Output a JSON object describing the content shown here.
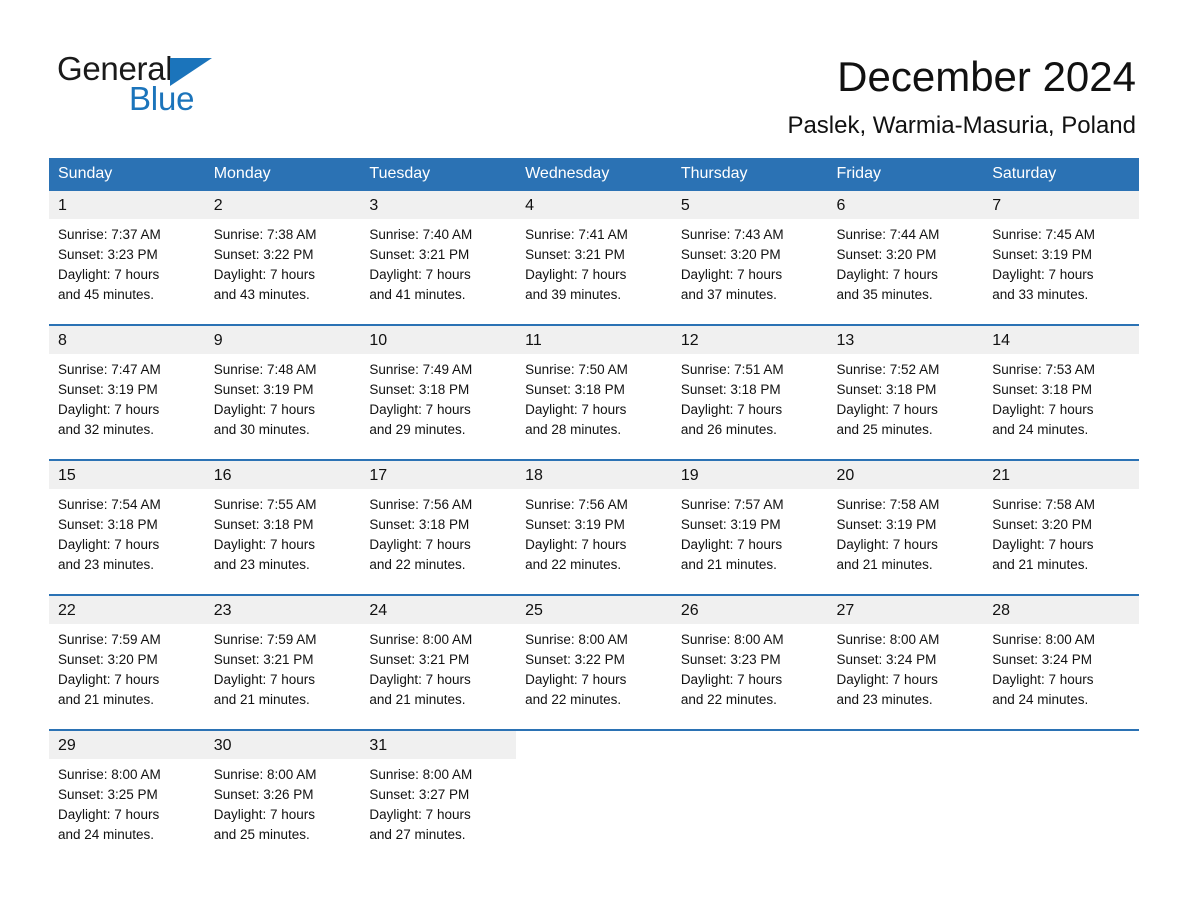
{
  "logo": {
    "word1": "General",
    "word2": "Blue",
    "flag_icon": "triangle-flag-icon",
    "brand_color": "#1b74bb"
  },
  "header": {
    "title": "December 2024",
    "subtitle": "Paslek, Warmia-Masuria, Poland"
  },
  "theme": {
    "header_blue": "#2b72b4",
    "daynum_gray": "#f0f0f0",
    "text_black": "#111111"
  },
  "calendar": {
    "weekday_headers": [
      "Sunday",
      "Monday",
      "Tuesday",
      "Wednesday",
      "Thursday",
      "Friday",
      "Saturday"
    ],
    "weeks": [
      [
        {
          "day": "1",
          "sunrise": "Sunrise: 7:37 AM",
          "sunset": "Sunset: 3:23 PM",
          "daylight1": "Daylight: 7 hours",
          "daylight2": "and 45 minutes."
        },
        {
          "day": "2",
          "sunrise": "Sunrise: 7:38 AM",
          "sunset": "Sunset: 3:22 PM",
          "daylight1": "Daylight: 7 hours",
          "daylight2": "and 43 minutes."
        },
        {
          "day": "3",
          "sunrise": "Sunrise: 7:40 AM",
          "sunset": "Sunset: 3:21 PM",
          "daylight1": "Daylight: 7 hours",
          "daylight2": "and 41 minutes."
        },
        {
          "day": "4",
          "sunrise": "Sunrise: 7:41 AM",
          "sunset": "Sunset: 3:21 PM",
          "daylight1": "Daylight: 7 hours",
          "daylight2": "and 39 minutes."
        },
        {
          "day": "5",
          "sunrise": "Sunrise: 7:43 AM",
          "sunset": "Sunset: 3:20 PM",
          "daylight1": "Daylight: 7 hours",
          "daylight2": "and 37 minutes."
        },
        {
          "day": "6",
          "sunrise": "Sunrise: 7:44 AM",
          "sunset": "Sunset: 3:20 PM",
          "daylight1": "Daylight: 7 hours",
          "daylight2": "and 35 minutes."
        },
        {
          "day": "7",
          "sunrise": "Sunrise: 7:45 AM",
          "sunset": "Sunset: 3:19 PM",
          "daylight1": "Daylight: 7 hours",
          "daylight2": "and 33 minutes."
        }
      ],
      [
        {
          "day": "8",
          "sunrise": "Sunrise: 7:47 AM",
          "sunset": "Sunset: 3:19 PM",
          "daylight1": "Daylight: 7 hours",
          "daylight2": "and 32 minutes."
        },
        {
          "day": "9",
          "sunrise": "Sunrise: 7:48 AM",
          "sunset": "Sunset: 3:19 PM",
          "daylight1": "Daylight: 7 hours",
          "daylight2": "and 30 minutes."
        },
        {
          "day": "10",
          "sunrise": "Sunrise: 7:49 AM",
          "sunset": "Sunset: 3:18 PM",
          "daylight1": "Daylight: 7 hours",
          "daylight2": "and 29 minutes."
        },
        {
          "day": "11",
          "sunrise": "Sunrise: 7:50 AM",
          "sunset": "Sunset: 3:18 PM",
          "daylight1": "Daylight: 7 hours",
          "daylight2": "and 28 minutes."
        },
        {
          "day": "12",
          "sunrise": "Sunrise: 7:51 AM",
          "sunset": "Sunset: 3:18 PM",
          "daylight1": "Daylight: 7 hours",
          "daylight2": "and 26 minutes."
        },
        {
          "day": "13",
          "sunrise": "Sunrise: 7:52 AM",
          "sunset": "Sunset: 3:18 PM",
          "daylight1": "Daylight: 7 hours",
          "daylight2": "and 25 minutes."
        },
        {
          "day": "14",
          "sunrise": "Sunrise: 7:53 AM",
          "sunset": "Sunset: 3:18 PM",
          "daylight1": "Daylight: 7 hours",
          "daylight2": "and 24 minutes."
        }
      ],
      [
        {
          "day": "15",
          "sunrise": "Sunrise: 7:54 AM",
          "sunset": "Sunset: 3:18 PM",
          "daylight1": "Daylight: 7 hours",
          "daylight2": "and 23 minutes."
        },
        {
          "day": "16",
          "sunrise": "Sunrise: 7:55 AM",
          "sunset": "Sunset: 3:18 PM",
          "daylight1": "Daylight: 7 hours",
          "daylight2": "and 23 minutes."
        },
        {
          "day": "17",
          "sunrise": "Sunrise: 7:56 AM",
          "sunset": "Sunset: 3:18 PM",
          "daylight1": "Daylight: 7 hours",
          "daylight2": "and 22 minutes."
        },
        {
          "day": "18",
          "sunrise": "Sunrise: 7:56 AM",
          "sunset": "Sunset: 3:19 PM",
          "daylight1": "Daylight: 7 hours",
          "daylight2": "and 22 minutes."
        },
        {
          "day": "19",
          "sunrise": "Sunrise: 7:57 AM",
          "sunset": "Sunset: 3:19 PM",
          "daylight1": "Daylight: 7 hours",
          "daylight2": "and 21 minutes."
        },
        {
          "day": "20",
          "sunrise": "Sunrise: 7:58 AM",
          "sunset": "Sunset: 3:19 PM",
          "daylight1": "Daylight: 7 hours",
          "daylight2": "and 21 minutes."
        },
        {
          "day": "21",
          "sunrise": "Sunrise: 7:58 AM",
          "sunset": "Sunset: 3:20 PM",
          "daylight1": "Daylight: 7 hours",
          "daylight2": "and 21 minutes."
        }
      ],
      [
        {
          "day": "22",
          "sunrise": "Sunrise: 7:59 AM",
          "sunset": "Sunset: 3:20 PM",
          "daylight1": "Daylight: 7 hours",
          "daylight2": "and 21 minutes."
        },
        {
          "day": "23",
          "sunrise": "Sunrise: 7:59 AM",
          "sunset": "Sunset: 3:21 PM",
          "daylight1": "Daylight: 7 hours",
          "daylight2": "and 21 minutes."
        },
        {
          "day": "24",
          "sunrise": "Sunrise: 8:00 AM",
          "sunset": "Sunset: 3:21 PM",
          "daylight1": "Daylight: 7 hours",
          "daylight2": "and 21 minutes."
        },
        {
          "day": "25",
          "sunrise": "Sunrise: 8:00 AM",
          "sunset": "Sunset: 3:22 PM",
          "daylight1": "Daylight: 7 hours",
          "daylight2": "and 22 minutes."
        },
        {
          "day": "26",
          "sunrise": "Sunrise: 8:00 AM",
          "sunset": "Sunset: 3:23 PM",
          "daylight1": "Daylight: 7 hours",
          "daylight2": "and 22 minutes."
        },
        {
          "day": "27",
          "sunrise": "Sunrise: 8:00 AM",
          "sunset": "Sunset: 3:24 PM",
          "daylight1": "Daylight: 7 hours",
          "daylight2": "and 23 minutes."
        },
        {
          "day": "28",
          "sunrise": "Sunrise: 8:00 AM",
          "sunset": "Sunset: 3:24 PM",
          "daylight1": "Daylight: 7 hours",
          "daylight2": "and 24 minutes."
        }
      ],
      [
        {
          "day": "29",
          "sunrise": "Sunrise: 8:00 AM",
          "sunset": "Sunset: 3:25 PM",
          "daylight1": "Daylight: 7 hours",
          "daylight2": "and 24 minutes."
        },
        {
          "day": "30",
          "sunrise": "Sunrise: 8:00 AM",
          "sunset": "Sunset: 3:26 PM",
          "daylight1": "Daylight: 7 hours",
          "daylight2": "and 25 minutes."
        },
        {
          "day": "31",
          "sunrise": "Sunrise: 8:00 AM",
          "sunset": "Sunset: 3:27 PM",
          "daylight1": "Daylight: 7 hours",
          "daylight2": "and 27 minutes."
        },
        {
          "day": "",
          "sunrise": "",
          "sunset": "",
          "daylight1": "",
          "daylight2": ""
        },
        {
          "day": "",
          "sunrise": "",
          "sunset": "",
          "daylight1": "",
          "daylight2": ""
        },
        {
          "day": "",
          "sunrise": "",
          "sunset": "",
          "daylight1": "",
          "daylight2": ""
        },
        {
          "day": "",
          "sunrise": "",
          "sunset": "",
          "daylight1": "",
          "daylight2": ""
        }
      ]
    ]
  }
}
